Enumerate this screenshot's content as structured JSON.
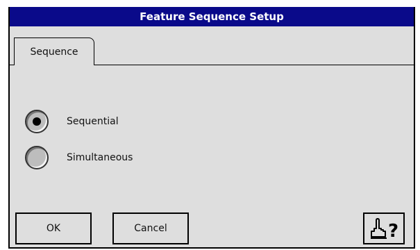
{
  "dialog": {
    "title": "Feature Sequence Setup",
    "tabs": [
      {
        "label": "Sequence"
      }
    ],
    "options": [
      {
        "label": "Sequential",
        "selected": true
      },
      {
        "label": "Simultaneous",
        "selected": false
      }
    ],
    "buttons": {
      "ok": "OK",
      "cancel": "Cancel"
    },
    "help_icon": "hand-question-icon",
    "help_glyph": "?",
    "colors": {
      "title_bar": "#0a0a8a",
      "background": "#dedede",
      "border": "#000000"
    }
  }
}
